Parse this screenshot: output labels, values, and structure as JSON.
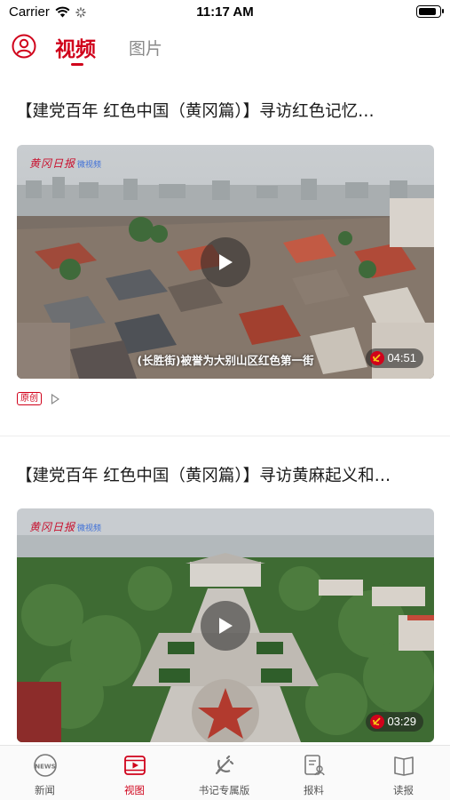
{
  "status_bar": {
    "carrier": "Carrier",
    "time": "11:17 AM",
    "battery_level": 0.9
  },
  "header": {
    "user_icon": "user-circle-icon",
    "tabs": [
      {
        "label": "视频",
        "active": true
      },
      {
        "label": "图片",
        "active": false
      }
    ],
    "accent_color": "#d0021b"
  },
  "feed": {
    "items": [
      {
        "title": "【建党百年 红色中国（黄冈篇）】寻访红色记忆…",
        "watermark": "黄冈日报",
        "watermark_sub": "微视频",
        "caption": "(长胜街)被誉为大别山区红色第一街",
        "duration": "04:51",
        "badge": "原创",
        "scene": "rooftops"
      },
      {
        "title": "【建党百年 红色中国（黄冈篇）】寻访黄麻起义和…",
        "watermark": "黄冈日报",
        "watermark_sub": "微视频",
        "caption": "",
        "duration": "03:29",
        "scene": "memorial"
      }
    ]
  },
  "tabbar": {
    "items": [
      {
        "label": "新闻",
        "icon": "news-icon",
        "active": false
      },
      {
        "label": "视图",
        "icon": "video-play-icon",
        "active": true
      },
      {
        "label": "书记专属版",
        "icon": "party-emblem-icon",
        "active": false
      },
      {
        "label": "报料",
        "icon": "report-tip-icon",
        "active": false
      },
      {
        "label": "读报",
        "icon": "newspaper-icon",
        "active": false
      }
    ]
  }
}
